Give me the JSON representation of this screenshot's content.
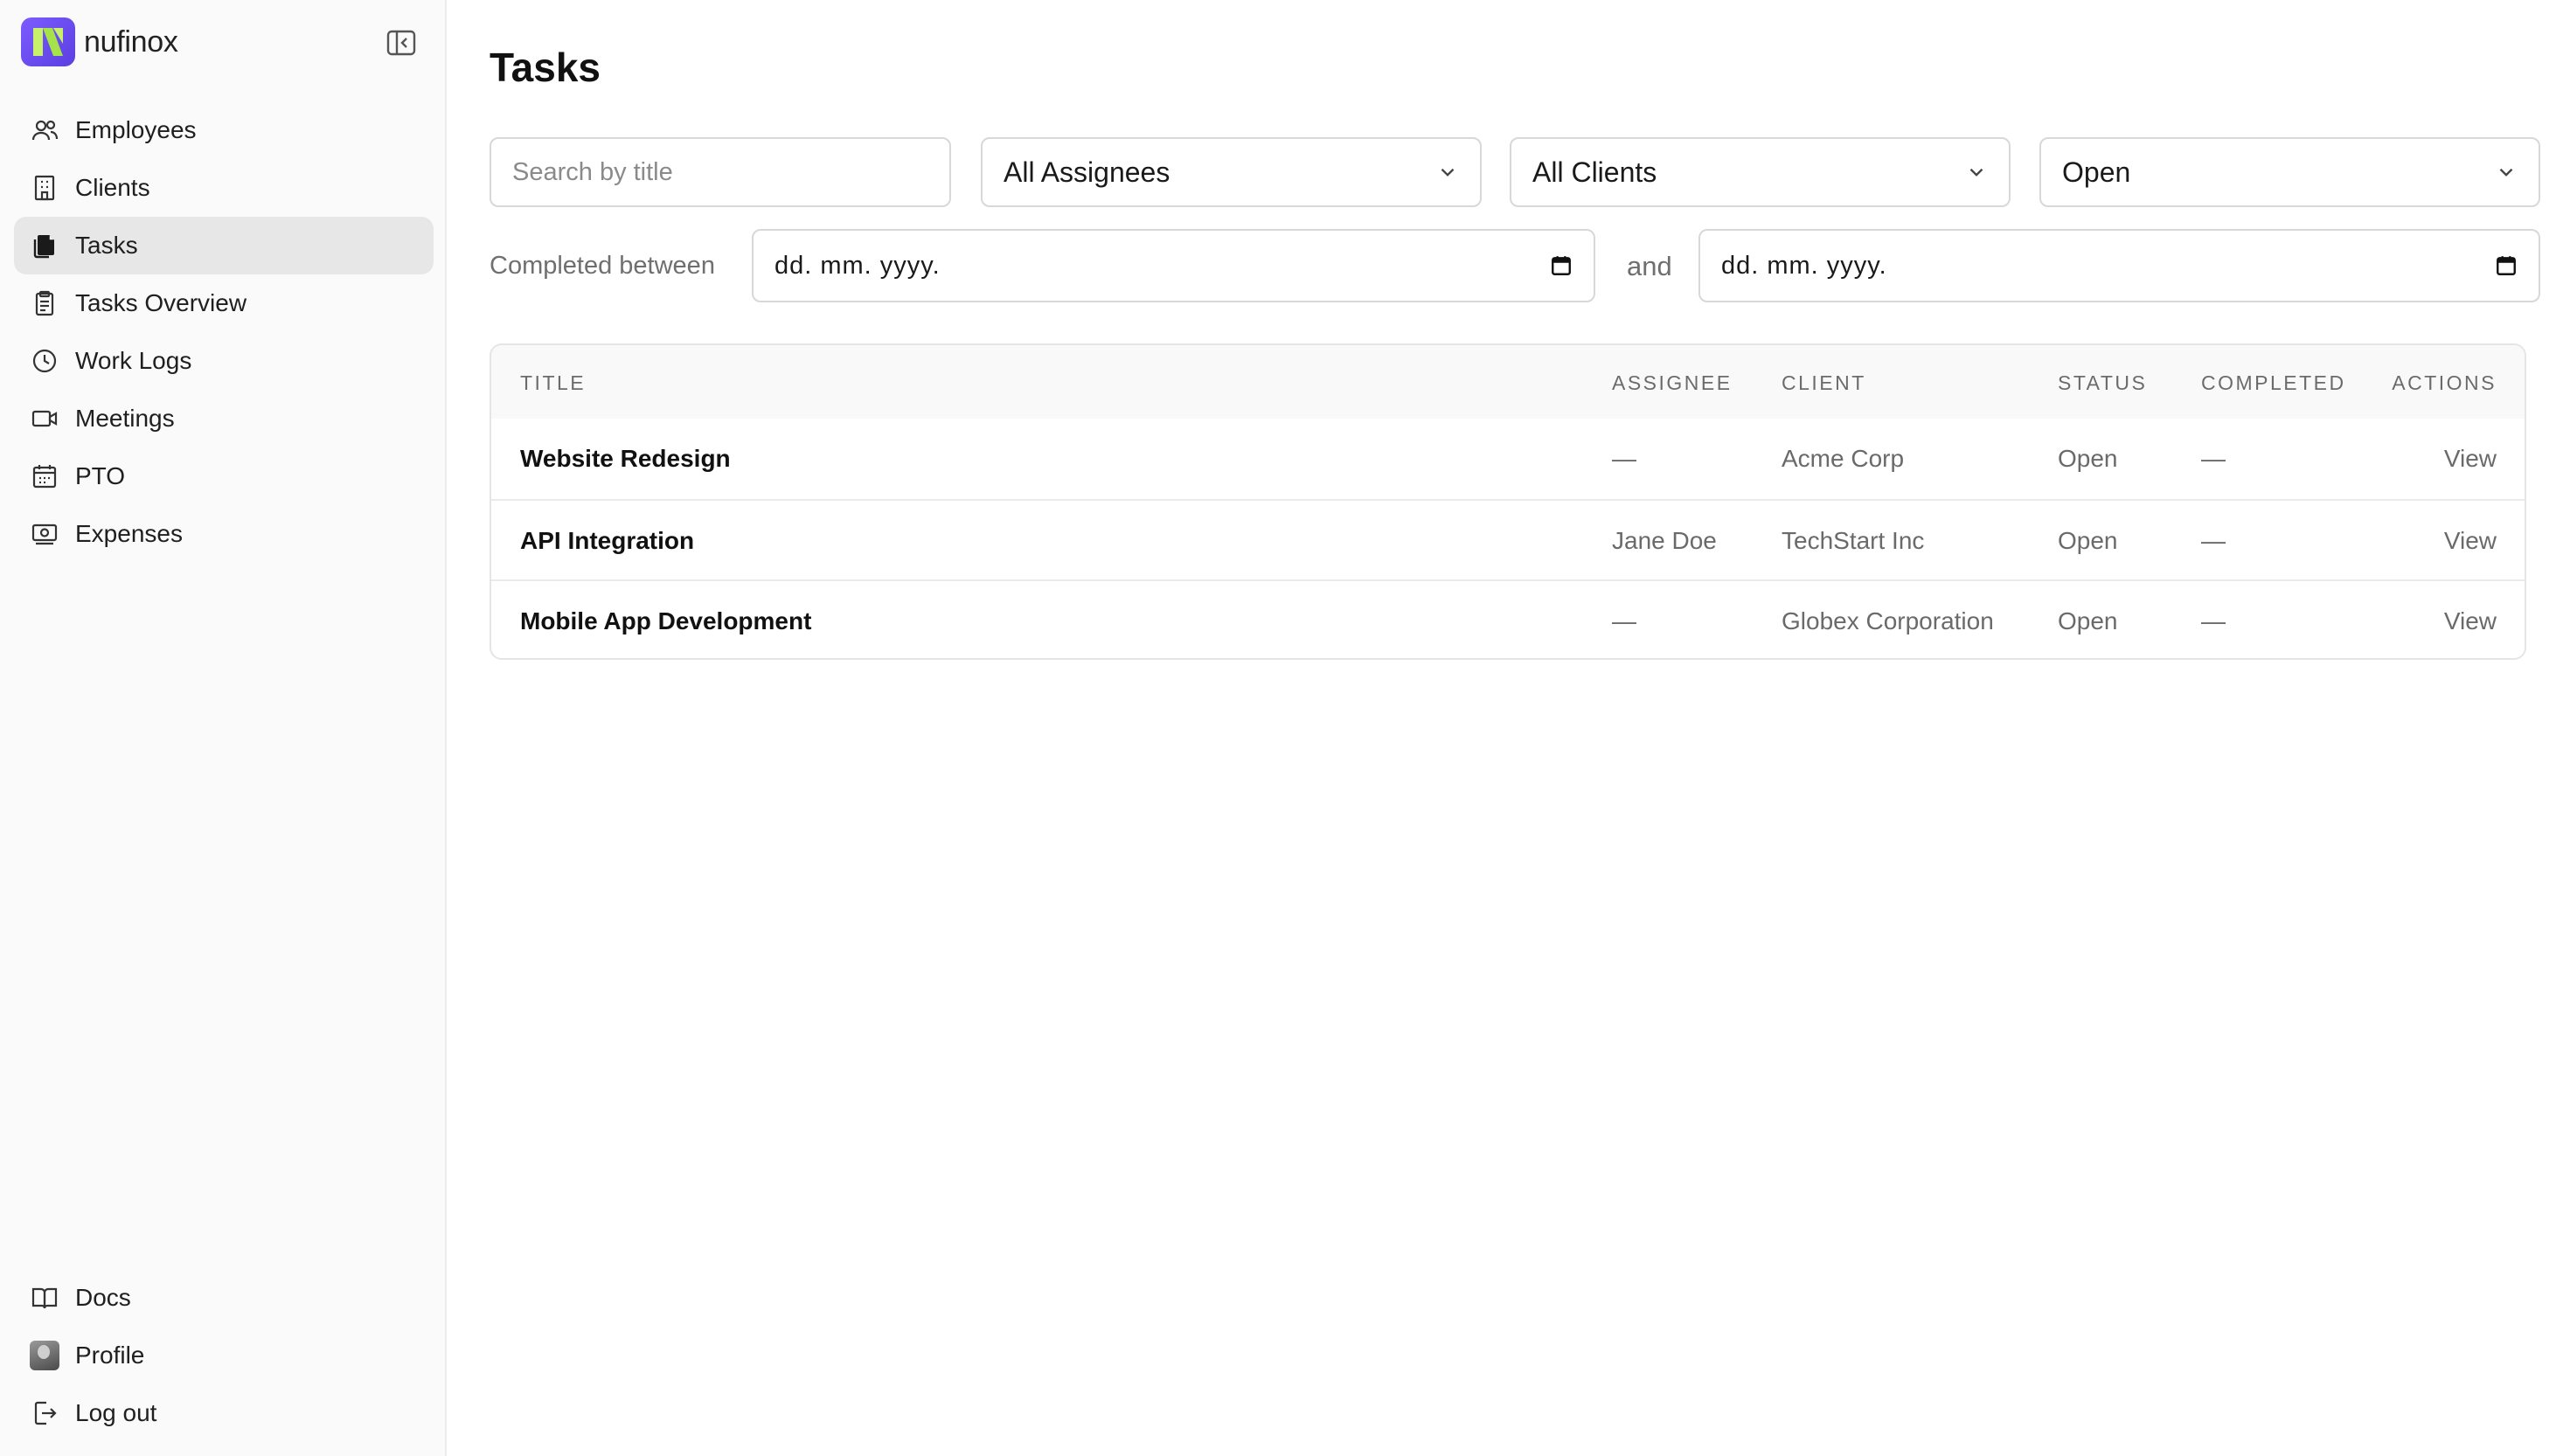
{
  "brand": {
    "name": "nufinox"
  },
  "sidebar": {
    "items": [
      {
        "label": "Employees",
        "icon": "users-icon"
      },
      {
        "label": "Clients",
        "icon": "building-icon"
      },
      {
        "label": "Tasks",
        "icon": "documents-icon",
        "active": true
      },
      {
        "label": "Tasks Overview",
        "icon": "clipboard-icon"
      },
      {
        "label": "Work Logs",
        "icon": "clock-icon"
      },
      {
        "label": "Meetings",
        "icon": "video-icon"
      },
      {
        "label": "PTO",
        "icon": "calendar-icon"
      },
      {
        "label": "Expenses",
        "icon": "money-icon"
      }
    ],
    "bottom": [
      {
        "label": "Docs",
        "icon": "book-icon"
      },
      {
        "label": "Profile",
        "icon": "avatar"
      },
      {
        "label": "Log out",
        "icon": "logout-icon"
      }
    ]
  },
  "page": {
    "title": "Tasks"
  },
  "filters": {
    "search_placeholder": "Search by title",
    "assignee": "All Assignees",
    "client": "All Clients",
    "status": "Open",
    "completed_label": "Completed between",
    "and_label": "and",
    "date_from": "dd. mm. yyyy.",
    "date_to": "dd. mm. yyyy."
  },
  "table": {
    "columns": [
      "Title",
      "Assignee",
      "Client",
      "Status",
      "Completed",
      "Actions"
    ],
    "rows": [
      {
        "title": "Website Redesign",
        "assignee": "—",
        "client": "Acme Corp",
        "status": "Open",
        "completed": "—",
        "action": "View"
      },
      {
        "title": "API Integration",
        "assignee": "Jane Doe",
        "client": "TechStart Inc",
        "status": "Open",
        "completed": "—",
        "action": "View"
      },
      {
        "title": "Mobile App Development",
        "assignee": "—",
        "client": "Globex Corporation",
        "status": "Open",
        "completed": "—",
        "action": "View"
      }
    ]
  },
  "colors": {
    "brand": "#6b4ef0",
    "active_bg": "#e7e7e7",
    "border": "#d8d8d8"
  }
}
